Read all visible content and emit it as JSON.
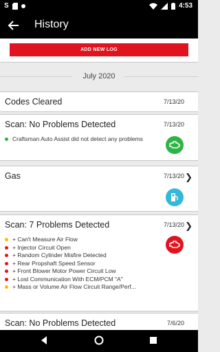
{
  "status_bar": {
    "time": "4:53",
    "left_icons": [
      "s-icon",
      "sd-card-icon",
      "dot-icon"
    ],
    "right_icons": [
      "wifi-icon",
      "signal-icon",
      "battery-icon"
    ]
  },
  "app_bar": {
    "title": "History",
    "back_icon": "arrow-left-icon"
  },
  "add_button": {
    "label": "ADD NEW LOG",
    "color": "#e0141e"
  },
  "month_header": "July 2020",
  "entries": [
    {
      "title": "Codes Cleared",
      "date": "7/13/20"
    },
    {
      "title": "Scan: No Problems Detected",
      "date": "7/13/20",
      "items": [
        "Craftsman Auto Assist did not detect any problems"
      ],
      "icon": "engine-icon",
      "icon_color": "#2fb344"
    },
    {
      "title": "Gas",
      "date": "7/13/20",
      "icon": "fuel-pump-icon",
      "icon_color": "#35b8d8"
    },
    {
      "title": "Scan: 7 Problems Detected",
      "date": "7/13/20",
      "items": [
        {
          "severity": "yellow",
          "text": "+ Can't Measure Air Flow"
        },
        {
          "severity": "red",
          "text": "+ Injector Circuit Open"
        },
        {
          "severity": "red",
          "text": "+ Random Cylinder Misfire Detected"
        },
        {
          "severity": "red",
          "text": "+ Rear Propshaft Speed Sensor"
        },
        {
          "severity": "red",
          "text": "+ Front Blower Motor Power Circuit Low"
        },
        {
          "severity": "red",
          "text": "+ Lost Communication With ECM/PCM \"A\""
        },
        {
          "severity": "yellow",
          "text": "+ Mass or Volume Air Flow Circuit Range/Perf..."
        }
      ],
      "icon": "engine-icon",
      "icon_color": "#e0141e"
    },
    {
      "title": "Scan: No Problems Detected",
      "date": "7/6/20"
    }
  ],
  "nav_bar": {
    "icons": [
      "back-triangle-icon",
      "home-circle-icon",
      "recents-square-icon"
    ]
  }
}
